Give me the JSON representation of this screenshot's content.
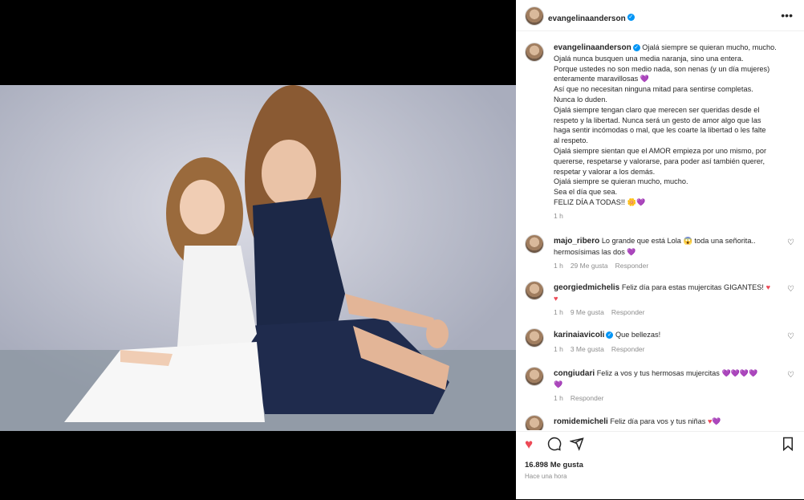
{
  "post": {
    "username": "evangelinaanderson",
    "caption_lines": [
      "Ojalá siempre se quieran mucho, mucho.",
      "Ojalá nunca busquen una media naranja, sino una entera.",
      "Porque ustedes no son medio nada, son nenas (y un día mujeres)",
      "enteramente maravillosas",
      "Así que no necesitan ninguna mitad para sentirse completas.",
      "Nunca lo duden.",
      "Ojalá siempre tengan claro que merecen ser queridas desde el",
      "respeto y la libertad. Nunca será un gesto de amor algo que las",
      "haga sentir incómodas o mal, que les coarte la libertad o les falte",
      "al respeto.",
      "Ojalá siempre sientan que el AMOR empieza por uno mismo, por",
      "quererse, respetarse y valorarse, para poder así también querer,",
      "respetar y valorar a los demás.",
      "Ojalá siempre se quieran mucho, mucho.",
      "Sea el día que sea.",
      "FELIZ DÍA A TODAS!!"
    ],
    "caption_time": "1 h",
    "likes": "16.898 Me gusta",
    "posted_ago": "Hace una hora"
  },
  "comments": [
    {
      "user": "majo_ribero",
      "text": "Lo grande que está Lola 😱 toda una señorita..",
      "text2": "hermosísimas las dos",
      "time": "1 h",
      "likes": "29 Me gusta",
      "reply": "Responder"
    },
    {
      "user": "georgiedmichelis",
      "text": "Feliz día para estas mujercitas GIGANTES!",
      "text2": "",
      "time": "1 h",
      "likes": "9 Me gusta",
      "reply": "Responder"
    },
    {
      "user": "karinaiavicoli",
      "text": "Que bellezas!",
      "text2": "",
      "time": "1 h",
      "likes": "3 Me gusta",
      "reply": "Responder"
    },
    {
      "user": "congiudari",
      "text": "Feliz a vos y tus hermosas mujercitas",
      "text2": "",
      "time": "1 h",
      "likes": "",
      "reply": "Responder"
    },
    {
      "user": "romidemicheli",
      "text": "Feliz día para vos y tus niñas",
      "text2": "",
      "time": "",
      "likes": "",
      "reply": ""
    }
  ],
  "icons": {
    "more": "more-options-icon",
    "like": "heart-icon",
    "comment": "comment-icon",
    "share": "share-icon",
    "save": "bookmark-icon"
  },
  "colors": {
    "liked": "#ed4956",
    "verified": "#0095f6",
    "meta": "#8e8e8e"
  }
}
